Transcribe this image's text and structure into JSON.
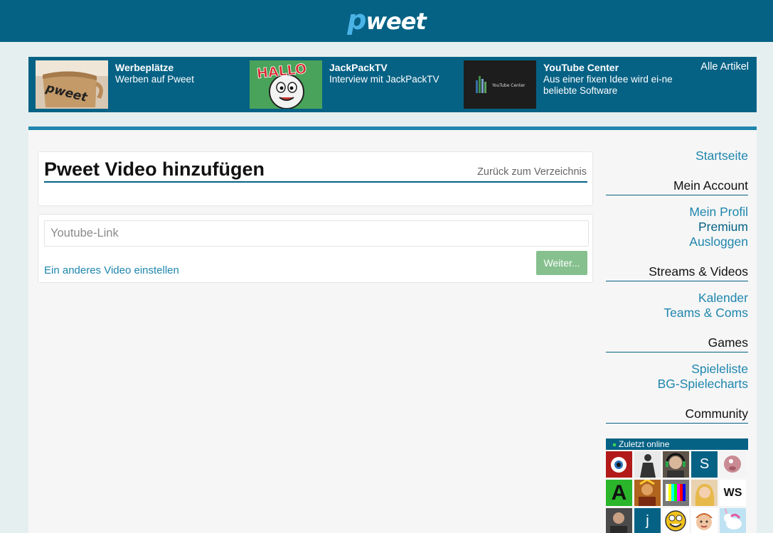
{
  "header": {
    "logo_p": "p",
    "logo_rest": "weet"
  },
  "promo": {
    "items": [
      {
        "title": "Werbeplätze",
        "subtitle": "Werben auf Pweet",
        "thumb_icon": "mug-icon"
      },
      {
        "title": "JackPackTV",
        "subtitle": "Interview mit JackPackTV",
        "thumb_icon": "hallo-cartoon-icon",
        "thumb_text": "HALLO"
      },
      {
        "title": "YouTube Center",
        "subtitle": "Aus einer fixen Idee wird ei-ne beliebte Software",
        "thumb_icon": "youtube-center-icon",
        "thumb_text": "YouTube Center"
      }
    ],
    "all_articles": "Alle Artikel"
  },
  "main": {
    "title": "Pweet Video hinzufügen",
    "back_link": "Zurück zum Verzeichnis",
    "youtube_placeholder": "Youtube-Link",
    "next_button": "Weiter...",
    "other_video_link": "Ein anderes Video einstellen"
  },
  "sidebar": {
    "home": "Startseite",
    "account": {
      "heading": "Mein Account",
      "links": [
        "Mein Profil",
        "Premium",
        "Ausloggen"
      ]
    },
    "streams": {
      "heading": "Streams & Videos",
      "links": [
        "Kalender",
        "Teams & Coms"
      ]
    },
    "games": {
      "heading": "Games",
      "links": [
        "Spieleliste",
        "BG-Spielecharts"
      ]
    },
    "community": {
      "heading": "Community",
      "online_label": "Zuletzt online"
    }
  },
  "colors": {
    "brand": "#066285",
    "accent": "#1e86ad",
    "button_green": "#86c08f",
    "online_dot": "#3cd05a"
  },
  "avatars": [
    {
      "icon": "red-eye-avatar",
      "letter": ""
    },
    {
      "icon": "boxer-avatar",
      "letter": ""
    },
    {
      "icon": "headset-man-avatar",
      "letter": ""
    },
    {
      "icon": "letter-avatar",
      "letter": "S"
    },
    {
      "icon": "pig-avatar",
      "letter": ""
    },
    {
      "icon": "green-a-avatar",
      "letter": "A"
    },
    {
      "icon": "warrior-avatar",
      "letter": ""
    },
    {
      "icon": "testcard-avatar",
      "letter": ""
    },
    {
      "icon": "blonde-avatar",
      "letter": ""
    },
    {
      "icon": "ws-logo-avatar",
      "letter": "WS"
    },
    {
      "icon": "man-avatar",
      "letter": ""
    },
    {
      "icon": "letter-avatar",
      "letter": "j"
    },
    {
      "icon": "smiley-avatar",
      "letter": ""
    },
    {
      "icon": "cartoon-boy-avatar",
      "letter": ""
    },
    {
      "icon": "unicorn-avatar",
      "letter": ""
    }
  ]
}
